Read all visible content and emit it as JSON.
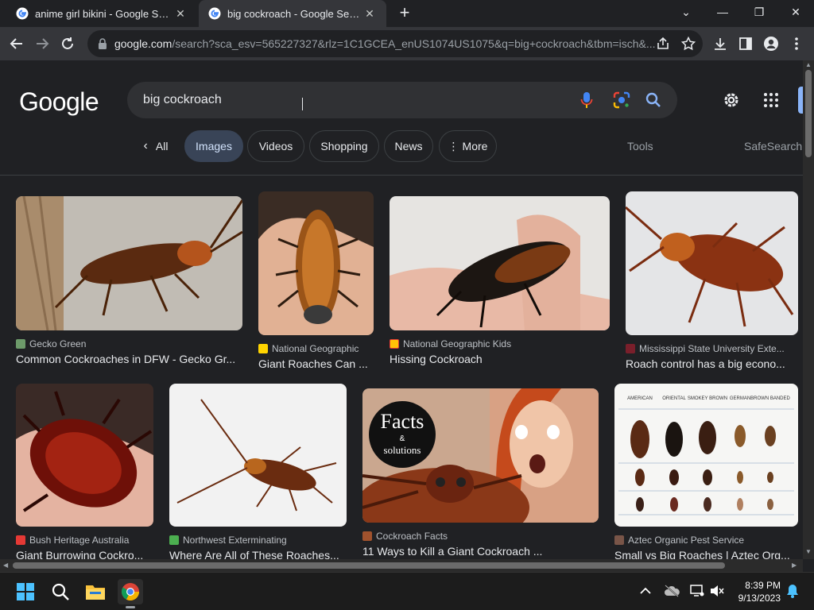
{
  "browser": {
    "tabs": [
      {
        "title": "anime girl bikini - Google Search",
        "active": false
      },
      {
        "title": "big cockroach - Google Search",
        "active": true
      }
    ],
    "url_host": "google.com",
    "url_path": "/search?sca_esv=565227327&rlz=1C1GCEA_enUS1074US1075&q=big+cockroach&tbm=isch&..."
  },
  "google": {
    "logo": "Google",
    "query": "big cockroach",
    "chips": [
      {
        "label": "All"
      },
      {
        "label": "Images"
      },
      {
        "label": "Videos"
      },
      {
        "label": "Shopping"
      },
      {
        "label": "News"
      },
      {
        "label": "More"
      }
    ],
    "tools_label": "Tools",
    "safesearch_label": "SafeSearch"
  },
  "results": [
    {
      "source": "Gecko Green",
      "caption": "Common Cockroaches in DFW - Gecko Gr..."
    },
    {
      "source": "National Geographic",
      "caption": "Giant Roaches Can ..."
    },
    {
      "source": "National Geographic Kids",
      "caption": "Hissing Cockroach"
    },
    {
      "source": "Mississippi State University Exte...",
      "caption": "Roach control has a big econo..."
    },
    {
      "source": "Bush Heritage Australia",
      "caption": "Giant Burrowing Cockro..."
    },
    {
      "source": "Northwest Exterminating",
      "caption": "Where Are All of These Roaches..."
    },
    {
      "source": "Cockroach Facts",
      "caption": "11 Ways to Kill a Giant Cockroach ..."
    },
    {
      "source": "Aztec Organic Pest Service",
      "caption": "Small vs Big Roaches | Aztec Org..."
    }
  ],
  "image_text": {
    "facts_badge_line1": "Facts",
    "facts_badge_line2": "&",
    "facts_badge_line3": "solutions",
    "species_labels": [
      "AMERICAN",
      "ORIENTAL",
      "SMOKEY BROWN",
      "GERMAN",
      "BROWN BANDED"
    ]
  },
  "taskbar": {
    "time": "8:39 PM",
    "date": "9/13/2023"
  },
  "colors": {
    "background": "#202124",
    "toolbar": "#35363a",
    "selected_chip": "#394457",
    "accent": "#8ab4f8"
  }
}
